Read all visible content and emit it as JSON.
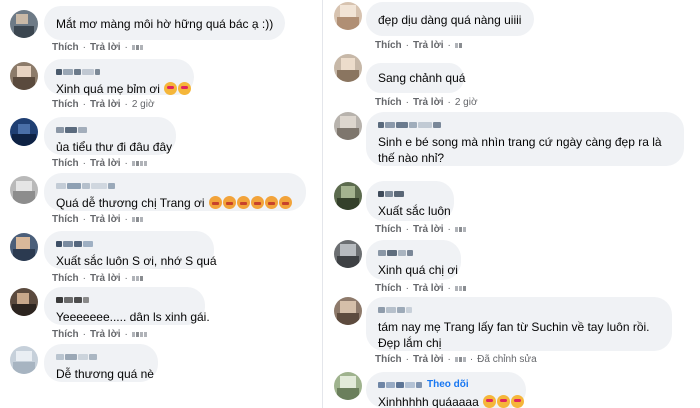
{
  "actions": {
    "like": "Thích",
    "reply": "Trả lời",
    "separator": "·"
  },
  "left": [
    {
      "text": "Mắt mơ màng môi hờ hững quá bác ạ :))",
      "time": "",
      "emojis": []
    },
    {
      "text": "Xinh quá mẹ bỉm ơi",
      "time": "2 giờ",
      "emojis": [
        "heart-eyes-emoji",
        "heart-eyes-emoji"
      ]
    },
    {
      "text": "ủa tiểu thư đi đâu đây",
      "time": "",
      "emojis": []
    },
    {
      "text": "Quá dễ thương chị Trang ơi",
      "time": "",
      "emojis": [
        "cat-heart-eyes-emoji",
        "cat-heart-eyes-emoji",
        "cat-heart-eyes-emoji",
        "cat-heart-eyes-emoji",
        "cat-heart-eyes-emoji",
        "cat-heart-eyes-emoji"
      ]
    },
    {
      "text": "Xuất sắc luôn S ơi, nhớ S quá",
      "time": "",
      "emojis": []
    },
    {
      "text": "Yeeeeeee..... dân ls xinh gái.",
      "time": "",
      "emojis": []
    },
    {
      "text": "Dễ thương quá nè",
      "time": "",
      "emojis": []
    }
  ],
  "right": [
    {
      "text": "đẹp dịu dàng quá nàng uiiii",
      "time": "",
      "emojis": []
    },
    {
      "text": "Sang chảnh quá",
      "time": "2 giờ",
      "emojis": []
    },
    {
      "text": "Sinh e bé song mà nhìn trang cứ ngày càng đẹp ra là thế nào nhỉ?",
      "time": "",
      "emojis": []
    },
    {
      "text": "Xuất sắc luôn",
      "time": "",
      "emojis": []
    },
    {
      "text": "Xinh quá chị ơi",
      "time": "",
      "emojis": []
    },
    {
      "text": "tám nay mẹ Trang lấy fan từ Suchin về tay luôn rồi. Đẹp lắm chị",
      "time": "",
      "edited": "Đã chỉnh sửa",
      "emojis": []
    },
    {
      "text": "Xinhhhhh quáaaaa",
      "time": "",
      "follow": "Theo dõi",
      "emojis": [
        "heart-face-emoji",
        "heart-face-emoji",
        "heart-face-emoji"
      ]
    }
  ],
  "colors": {
    "bubble": "#f0f2f5",
    "meta": "#65676b",
    "link": "#1877f2"
  }
}
